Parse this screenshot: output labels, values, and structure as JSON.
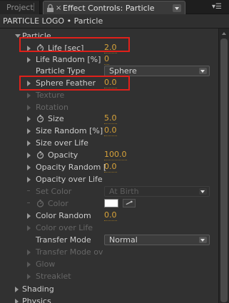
{
  "tabs": {
    "project": "Project",
    "active": "Effect Controls: Particle",
    "close": "×",
    "panel_menu": "▾☰"
  },
  "subheader": "PARTICLE LOGO • Particle",
  "tree": {
    "group": "Particle",
    "life": {
      "label": "Life [sec]",
      "value": "2.0"
    },
    "life_random": {
      "label": "Life Random [%]",
      "value": "0"
    },
    "particle_type": {
      "label": "Particle Type",
      "selected": "Sphere"
    },
    "sphere_feather": {
      "label": "Sphere Feather",
      "value": "0.0"
    },
    "texture": "Texture",
    "rotation": "Rotation",
    "size": {
      "label": "Size",
      "value": "5.0"
    },
    "size_random": {
      "label": "Size Random [%]",
      "value": "0.0"
    },
    "size_over_life": "Size over Life",
    "opacity": {
      "label": "Opacity",
      "value": "100.0"
    },
    "opacity_random": {
      "label": "Opacity Random [",
      "value": "0.0"
    },
    "opacity_over_life": "Opacity over Life",
    "set_color": {
      "label": "Set Color",
      "selected": "At Birth"
    },
    "color": {
      "label": "Color",
      "swatch": "#ffffff"
    },
    "color_random": {
      "label": "Color Random",
      "value": "0.0"
    },
    "color_over_life": "Color over Life",
    "transfer_mode": {
      "label": "Transfer Mode",
      "selected": "Normal"
    },
    "transfer_mode_over": "Transfer Mode ov",
    "glow": "Glow",
    "streaklet": "Streaklet",
    "shading": "Shading",
    "physics": "Physics"
  },
  "colors": {
    "highlight": "#e0201a",
    "value": "#d8a33a",
    "panel": "#313131"
  }
}
